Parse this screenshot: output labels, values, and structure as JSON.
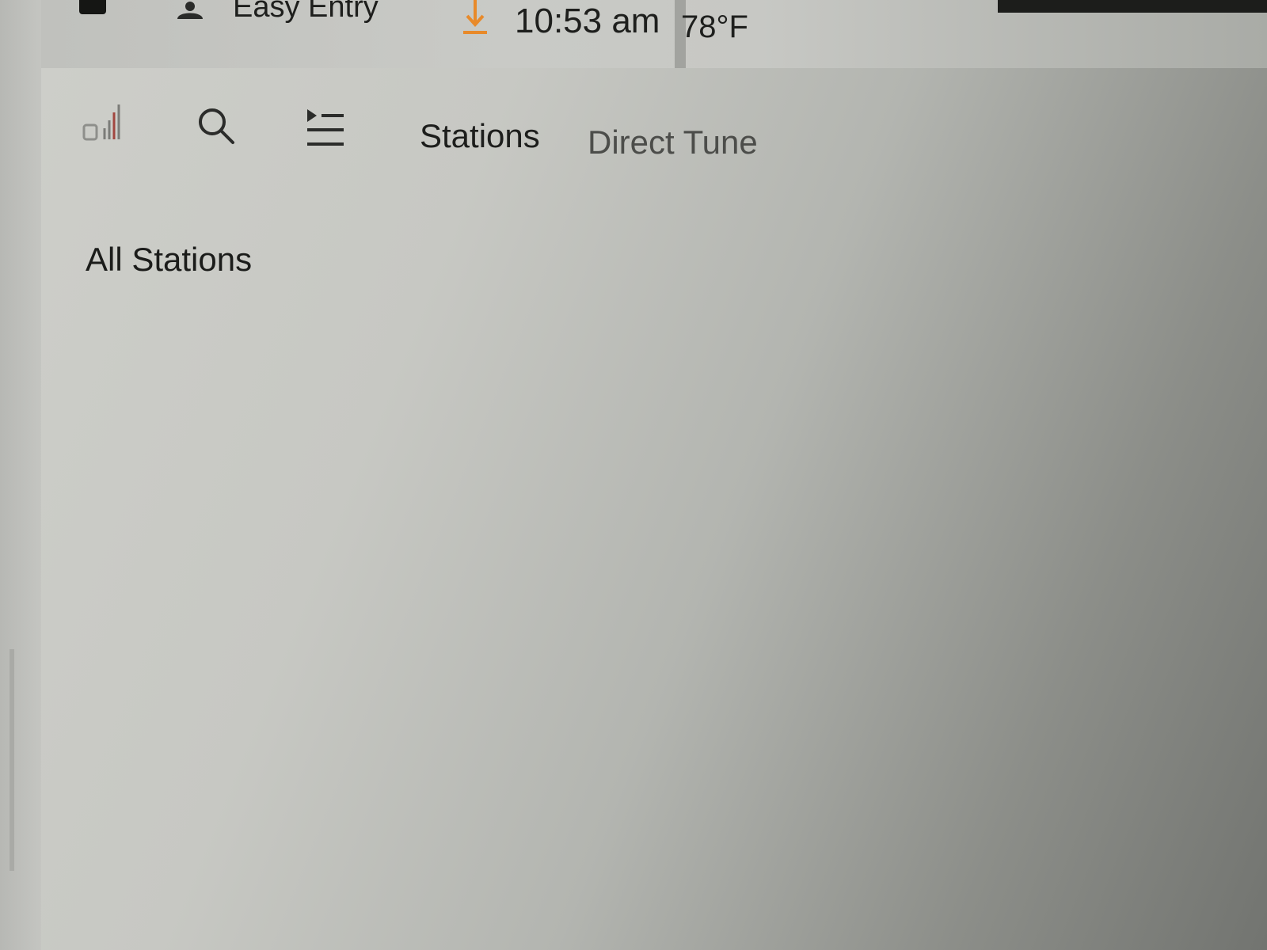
{
  "status_bar": {
    "profile_name": "Easy Entry",
    "time": "10:53 am",
    "temperature": "78°F",
    "icons": [
      "vehicle-icon",
      "profile-icon",
      "download-icon"
    ],
    "download_color": "#e88a2a"
  },
  "toolbar": {
    "icons": [
      "radio-source-icon",
      "search-icon",
      "queue-icon"
    ],
    "tabs": [
      {
        "label": "Stations",
        "active": true
      },
      {
        "label": "Direct Tune",
        "active": false
      }
    ]
  },
  "main": {
    "section_title": "All Stations"
  }
}
